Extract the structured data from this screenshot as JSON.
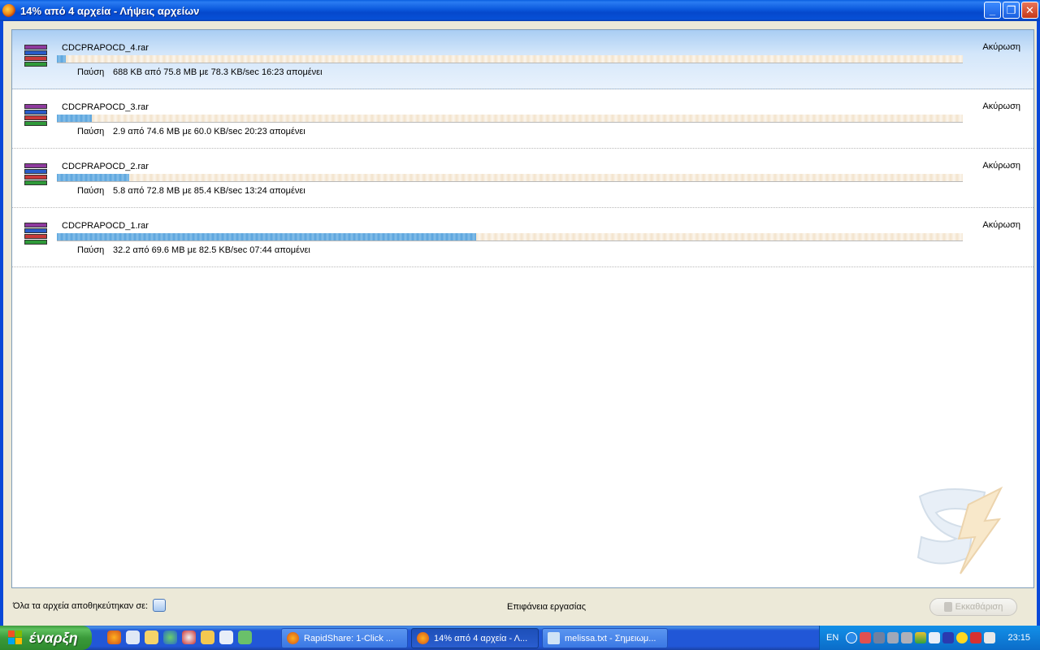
{
  "window": {
    "title": "14% από 4 αρχεία - Λήψεις αρχείων",
    "buttons": {
      "minimize": "_",
      "maximize": "❐",
      "close": "✕"
    }
  },
  "downloads": [
    {
      "file": "CDCPRAPOCD_4.rar",
      "pause": "Παύση",
      "status": "688 KB από 75.8 MB με 78.3 KB/sec 16:23 απομένει",
      "cancel": "Ακύρωση",
      "progress": 0.01,
      "selected": true
    },
    {
      "file": "CDCPRAPOCD_3.rar",
      "pause": "Παύση",
      "status": "2.9 από 74.6 MB με 60.0 KB/sec 20:23 απομένει",
      "cancel": "Ακύρωση",
      "progress": 0.039,
      "selected": false
    },
    {
      "file": "CDCPRAPOCD_2.rar",
      "pause": "Παύση",
      "status": "5.8 από 72.8 MB με 85.4 KB/sec 13:24 απομένει",
      "cancel": "Ακύρωση",
      "progress": 0.08,
      "selected": false
    },
    {
      "file": "CDCPRAPOCD_1.rar",
      "pause": "Παύση",
      "status": "32.2 από 69.6 MB με 82.5 KB/sec 07:44 απομένει",
      "cancel": "Ακύρωση",
      "progress": 0.463,
      "selected": false
    }
  ],
  "footer": {
    "saved_label": "Όλα τα αρχεία αποθηκεύτηκαν σε:",
    "location": "Επιφάνεια εργασίας",
    "clear_button": "Εκκαθάριση"
  },
  "taskbar": {
    "start_label": "έναρξη",
    "tasks": [
      {
        "label": "RapidShare: 1-Click ...",
        "icon": "firefox-icon",
        "active": false
      },
      {
        "label": "14% από 4 αρχεία - Λ...",
        "icon": "firefox-icon",
        "active": true
      },
      {
        "label": "melissa.txt - Σημειωμ...",
        "icon": "notepad-icon",
        "active": false
      }
    ],
    "language": "EN",
    "clock": "23:15"
  },
  "colors": {
    "titlebar": "#0a58dc",
    "progress": "#5aa4dd",
    "selected_row": "#a9cdf3",
    "start_button": "#3a9a3a",
    "taskbar": "#2157d7"
  }
}
